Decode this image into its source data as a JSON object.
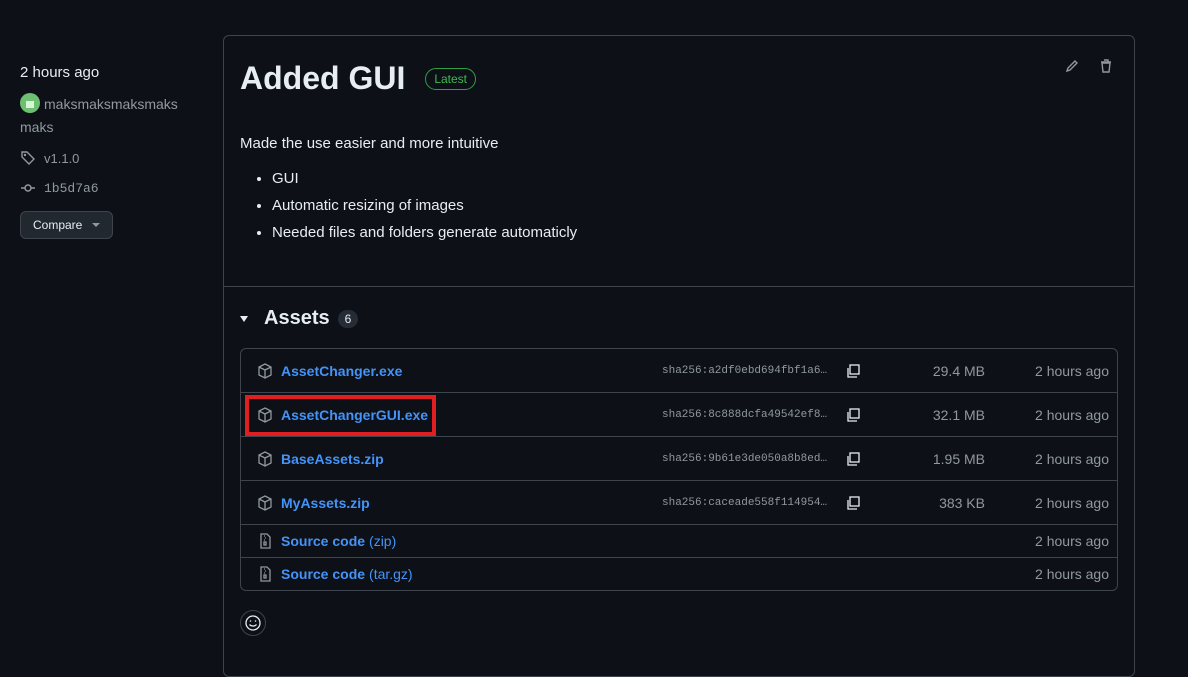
{
  "sidebar": {
    "time": "2 hours ago",
    "author_line1": "maksmaksmaksmaks",
    "author_line2": "maks",
    "tag": "v1.1.0",
    "commit": "1b5d7a6",
    "compare_label": "Compare"
  },
  "release": {
    "title": "Added GUI",
    "badge": "Latest",
    "description": "Made the use easier and more intuitive",
    "bullets": [
      "GUI",
      "Automatic resizing of images",
      "Needed files and folders generate automaticly"
    ]
  },
  "assets": {
    "title": "Assets",
    "count": "6",
    "rows": [
      {
        "name": "AssetChanger.exe",
        "sha": "sha256:a2df0ebd694fbf1a6…",
        "size": "29.4 MB",
        "date": "2 hours ago"
      },
      {
        "name": "AssetChangerGUI.exe",
        "sha": "sha256:8c888dcfa49542ef8…",
        "size": "32.1 MB",
        "date": "2 hours ago"
      },
      {
        "name": "BaseAssets.zip",
        "sha": "sha256:9b61e3de050a8b8ed…",
        "size": "1.95 MB",
        "date": "2 hours ago"
      },
      {
        "name": "MyAssets.zip",
        "sha": "sha256:caceade558f114954…",
        "size": "383 KB",
        "date": "2 hours ago"
      }
    ],
    "source": [
      {
        "name": "Source code",
        "ext": "(zip)",
        "date": "2 hours ago"
      },
      {
        "name": "Source code",
        "ext": "(tar.gz)",
        "date": "2 hours ago"
      }
    ]
  },
  "colors": {
    "accent": "#4493f8",
    "latest": "#3fb950",
    "highlight": "#e02020"
  }
}
